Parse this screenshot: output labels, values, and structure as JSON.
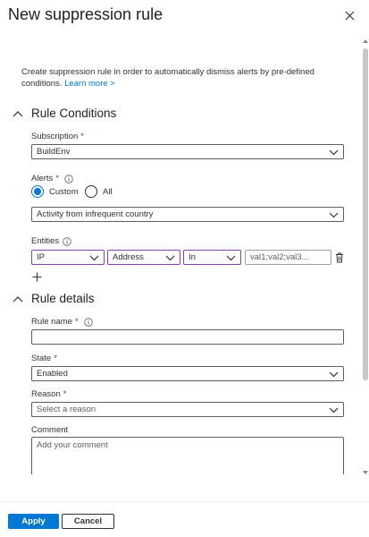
{
  "panel": {
    "title": "New suppression rule"
  },
  "description": {
    "text": "Create suppression rule in order to automatically dismiss alerts by pre-defined conditions.",
    "link": "Learn more >"
  },
  "rule_conditions": {
    "header": "Rule Conditions",
    "subscription": {
      "label": "Subscription",
      "required_mark": "*",
      "value": "BuildEnv"
    },
    "alerts": {
      "label": "Alerts",
      "required_mark": "*",
      "options": [
        {
          "label": "Custom",
          "checked": true
        },
        {
          "label": "All",
          "checked": false
        }
      ],
      "value": "Activity from infrequent country"
    },
    "entities": {
      "label": "Entities",
      "type_value": "IP",
      "field_value": "Address",
      "operator_value": "In",
      "values_placeholder": "val1;val2;val3...",
      "add_glyph": "+"
    }
  },
  "rule_details": {
    "header": "Rule details",
    "rule_name": {
      "label": "Rule name",
      "required_mark": "*",
      "value": ""
    },
    "state": {
      "label": "State",
      "required_mark": "*",
      "value": "Enabled"
    },
    "reason": {
      "label": "Reason",
      "required_mark": "*",
      "placeholder": "Select a reason"
    },
    "comment": {
      "label": "Comment",
      "placeholder": "Add your comment"
    }
  },
  "footer": {
    "apply_label": "Apply",
    "cancel_label": "Cancel"
  },
  "colors": {
    "accent": "#0078d4",
    "required": "#a4262c",
    "entity_border": "#8b3fa8",
    "border": "#605e5c"
  },
  "icons": {
    "close": "close-icon",
    "collapse": "chevron-up-icon",
    "dropdown": "chevron-down-icon",
    "info": "info-icon",
    "delete": "trash-icon",
    "add": "plus-icon"
  }
}
